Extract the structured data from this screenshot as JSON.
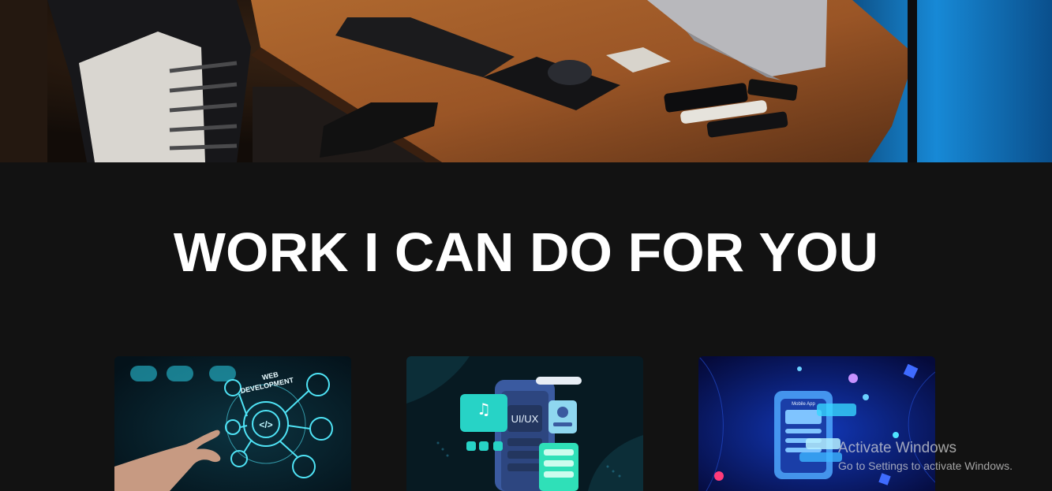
{
  "hero": {
    "image": "desk-workspace-photo"
  },
  "section": {
    "title": "WORK I CAN DO FOR YOU"
  },
  "cards": [
    {
      "image": "web-development-illustration",
      "label": "WEB DEVELOPMENT"
    },
    {
      "image": "ui-ux-design-illustration",
      "label": "UI/UX"
    },
    {
      "image": "mobile-app-illustration",
      "label": "Mobile App"
    }
  ],
  "watermark": {
    "title": "Activate Windows",
    "subtitle": "Go to Settings to activate Windows."
  },
  "colors": {
    "background": "#121212",
    "text": "#ffffff",
    "accent_cyan": "#1fd6e6",
    "accent_blue": "#2b6cff"
  }
}
